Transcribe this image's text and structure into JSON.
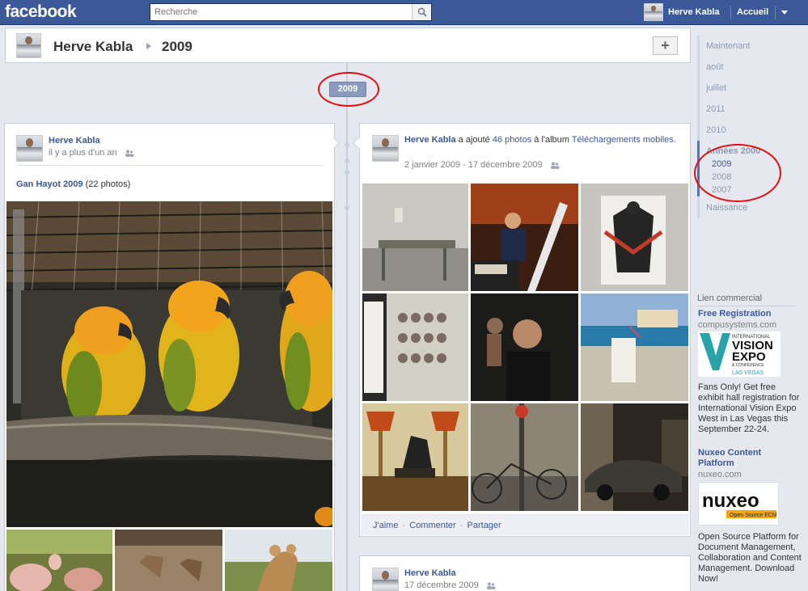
{
  "topbar": {
    "logo": "facebook",
    "search_placeholder": "Recherche",
    "user_name": "Herve Kabla",
    "home_label": "Accueil"
  },
  "profile_header": {
    "name": "Herve Kabla",
    "year": "2009",
    "add_label": "+"
  },
  "timeline": {
    "year_marker": "2009"
  },
  "left_card": {
    "author": "Herve Kabla",
    "time": "il y a plus d'un an",
    "album_title": "Gan Hayot 2009",
    "album_count": "(22 photos)"
  },
  "right_card": {
    "author": "Herve Kabla",
    "text_added": "a ajouté",
    "photo_count": "46 photos",
    "text_album": "à l'album",
    "album_name": "Téléchargements mobiles.",
    "date_range": "2 janvier 2009 - 17 décembre 2009",
    "actions": {
      "like": "J'aime",
      "comment": "Commenter",
      "share": "Partager"
    },
    "photos": [
      "empty-office",
      "piano-player",
      "wall-poster",
      "poster-crowd",
      "man-in-dark",
      "pool-glass",
      "lamps-statue",
      "bicycle-street",
      "car-at-night"
    ]
  },
  "right_card2": {
    "author": "Herve Kabla",
    "date": "17 décembre 2009"
  },
  "sidebar": {
    "nav": [
      {
        "label": "Maintenant"
      },
      {
        "label": "août"
      },
      {
        "label": "juillet"
      },
      {
        "label": "2011"
      },
      {
        "label": "2010"
      },
      {
        "label": "Années 2000"
      },
      {
        "label": "Naissance"
      }
    ],
    "nav_sub": [
      {
        "label": "2009"
      },
      {
        "label": "2008"
      },
      {
        "label": "2007"
      }
    ],
    "ads_label": "Lien commercial",
    "ads": [
      {
        "title": "Free Registration",
        "url": "compusystems.com",
        "logo_top": "INTERNATIONAL",
        "logo_vision": "VISION",
        "logo_expo": "EXPO",
        "logo_conf": "& CONFERENCE",
        "logo_city": "LAS VEGAS",
        "body": "Fans Only! Get free exhibit hall registration for International Vision Expo West in Las Vegas this September 22-24."
      },
      {
        "title": "Nuxeo Content Platform",
        "url": "nuxeo.com",
        "logo_word": "nuxeo",
        "logo_tag": "Open Source ECM",
        "body": "Open Source Platform for Document Management, Collaboration and Content Management. Download Now!"
      }
    ]
  },
  "colors": {
    "brand_blue": "#3b5998",
    "annotation_red": "#e01010"
  }
}
